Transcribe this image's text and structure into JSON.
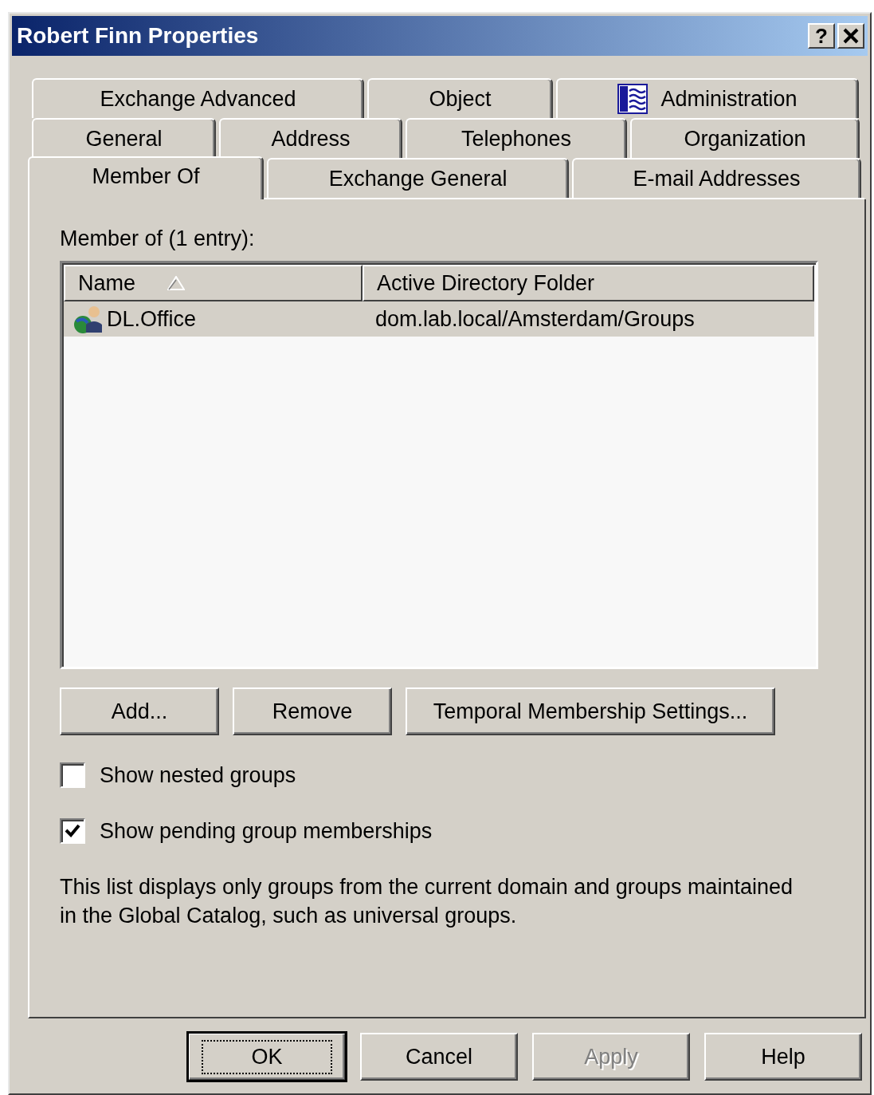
{
  "window": {
    "title": "Robert Finn Properties",
    "help_button": "?"
  },
  "tab_rows": [
    [
      {
        "label": "Exchange Advanced",
        "selected": false,
        "kind": "text"
      },
      {
        "label": "Object",
        "selected": false,
        "kind": "text"
      },
      {
        "label": "Administration",
        "selected": false,
        "kind": "icon"
      }
    ],
    [
      {
        "label": "General",
        "selected": false,
        "kind": "text"
      },
      {
        "label": "Address",
        "selected": false,
        "kind": "text"
      },
      {
        "label": "Telephones",
        "selected": false,
        "kind": "text"
      },
      {
        "label": "Organization",
        "selected": false,
        "kind": "text"
      }
    ],
    [
      {
        "label": "Member Of",
        "selected": true,
        "kind": "text"
      },
      {
        "label": "Exchange General",
        "selected": false,
        "kind": "text"
      },
      {
        "label": "E-mail Addresses",
        "selected": false,
        "kind": "text"
      }
    ]
  ],
  "member_list": {
    "label": "Member of (1 entry):",
    "columns": [
      {
        "label": "Name",
        "sorted": true
      },
      {
        "label": "Active Directory Folder",
        "sorted": false
      }
    ],
    "rows": [
      {
        "name": "DL.Office",
        "folder": "dom.lab.local/Amsterdam/Groups",
        "selected": true
      }
    ]
  },
  "buttons": [
    {
      "label": "Add..."
    },
    {
      "label": "Remove"
    },
    {
      "label": "Temporal Membership Settings..."
    }
  ],
  "checkboxes": [
    {
      "label": "Show nested groups",
      "checked": false
    },
    {
      "label": "Show pending group memberships",
      "checked": true
    }
  ],
  "note": "This list displays only groups from the current domain and groups maintained in the Global Catalog, such as universal groups.",
  "footer_buttons": [
    {
      "label": "OK",
      "default": true,
      "disabled": false
    },
    {
      "label": "Cancel",
      "default": false,
      "disabled": false
    },
    {
      "label": "Apply",
      "default": false,
      "disabled": true
    },
    {
      "label": "Help",
      "default": false,
      "disabled": false
    }
  ]
}
